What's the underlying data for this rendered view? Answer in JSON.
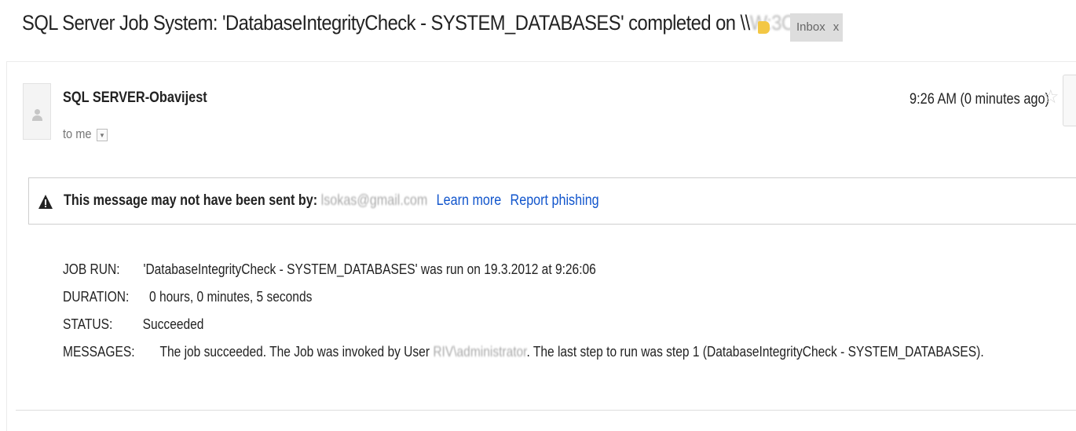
{
  "subject": {
    "text": "SQL Server Job System: 'DatabaseIntegrityCheck - SYSTEM_DATABASES' completed on \\\\",
    "redacted": "W:3O1O",
    "label": "Inbox",
    "label_close": "x",
    "importance_color": "#f3c744"
  },
  "message": {
    "sender": "SQL SERVER-Obavijest",
    "to": "to me",
    "details_icon": "chevron-down-icon",
    "time": "9:26 AM (0 minutes ago)",
    "star_icon": "star-icon",
    "warning": {
      "icon": "warning-icon",
      "text": "This message may not have been sent by:",
      "address": "lsokas@gmail.com",
      "learn_more": "Learn more",
      "report": "Report phishing",
      "link_color": "#1155cc"
    },
    "body": {
      "job_run_label": "JOB RUN:",
      "job_run_value": "'DatabaseIntegrityCheck - SYSTEM_DATABASES' was run on 19.3.2012 at 9:26:06",
      "duration_label": "DURATION:",
      "duration_value": "0 hours, 0 minutes, 5 seconds",
      "status_label": "STATUS:",
      "status_value": "Succeeded",
      "messages_label": "MESSAGES:",
      "messages_prefix": "The job succeeded.  The Job was invoked by User",
      "messages_user": "RIV\\administrator",
      "messages_suffix": ".  The last step to run was step 1 (DatabaseIntegrityCheck - SYSTEM_DATABASES)."
    }
  }
}
